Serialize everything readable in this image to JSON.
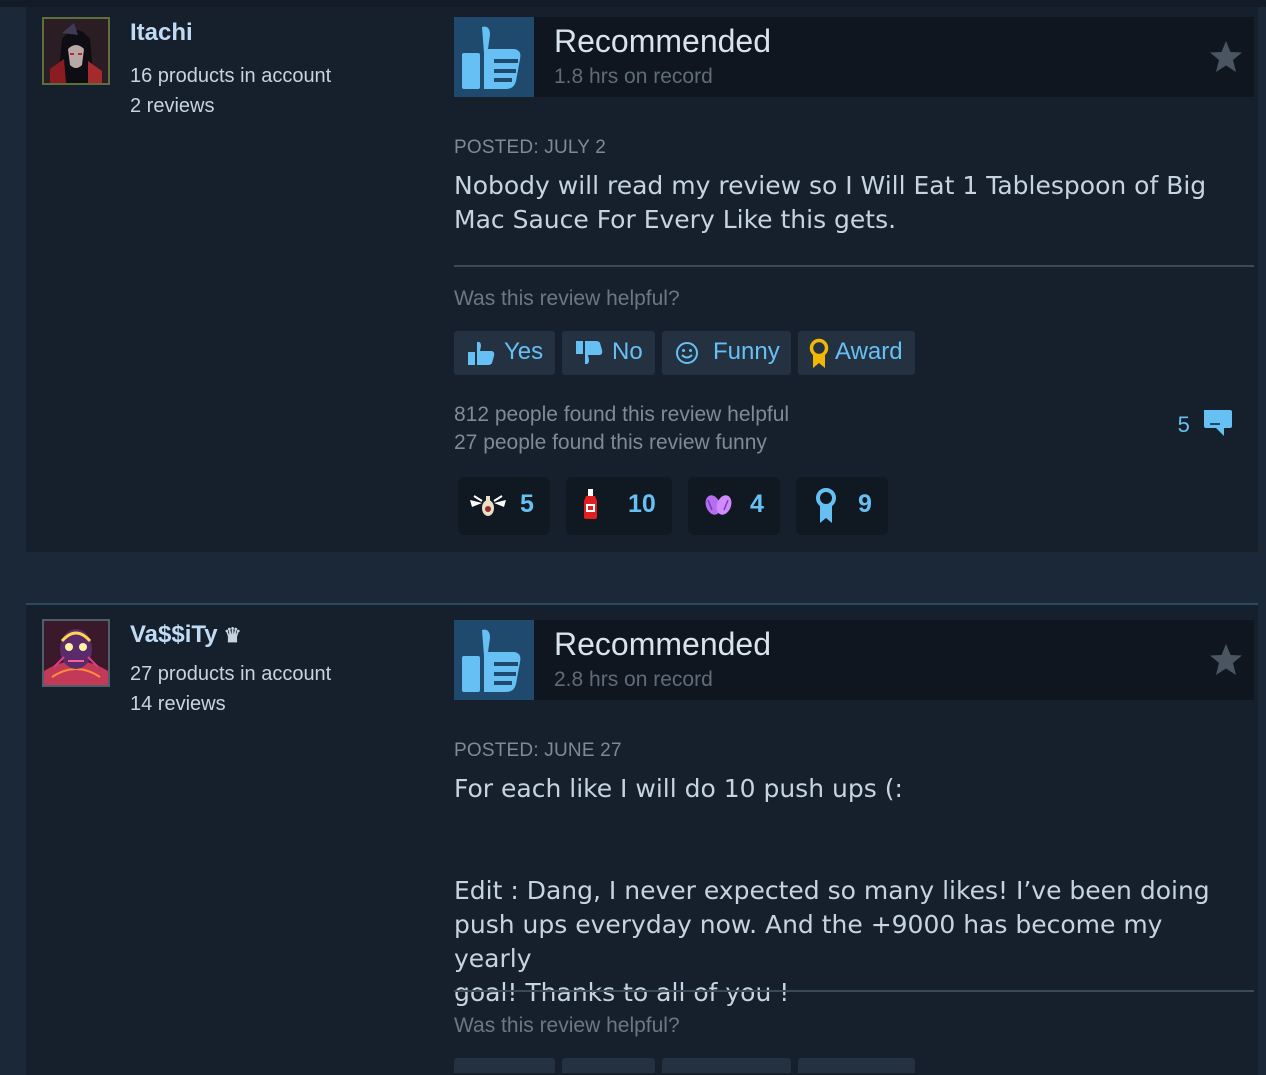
{
  "reviews": [
    {
      "user": {
        "name": "Itachi",
        "products": "16 products in account",
        "reviews": "2 reviews"
      },
      "recommendation": "Recommended",
      "hours": "1.8 hrs on record",
      "posted": "POSTED: JULY 2",
      "body": [
        "Nobody will read my review so I Will Eat 1 Tablespoon of Big",
        "Mac Sauce For Every Like this gets."
      ],
      "helpful_question": "Was this review helpful?",
      "buttons": {
        "yes": "Yes",
        "no": "No",
        "funny": "Funny",
        "award": "Award"
      },
      "helpful_count": "812 people found this review helpful",
      "funny_count": "27 people found this review funny",
      "comments": "5",
      "awards": [
        {
          "icon": "winged-bottle-icon",
          "count": "5"
        },
        {
          "icon": "sauce-bottle-icon",
          "count": "10"
        },
        {
          "icon": "purple-clap-icon",
          "count": "4"
        },
        {
          "icon": "ribbon-medal-icon",
          "count": "9"
        }
      ]
    },
    {
      "user": {
        "name": "Va$$iTy",
        "badge": "♛",
        "products": "27 products in account",
        "reviews": "14 reviews"
      },
      "recommendation": "Recommended",
      "hours": "2.8 hrs on record",
      "posted": "POSTED: JUNE 27",
      "body": [
        "For each like I will do 10 push ups (:",
        "",
        "",
        "Edit : Dang, I never expected so many likes! I’ve been doing",
        "push ups everyday now. And the +9000 has become my yearly",
        "goal! Thanks to all of you !"
      ],
      "helpful_question": "Was this review helpful?"
    }
  ],
  "colors": {
    "accent": "#66c0f4",
    "panel": "#16202d",
    "background": "#1b2838",
    "award_gold": "#f2b705"
  }
}
